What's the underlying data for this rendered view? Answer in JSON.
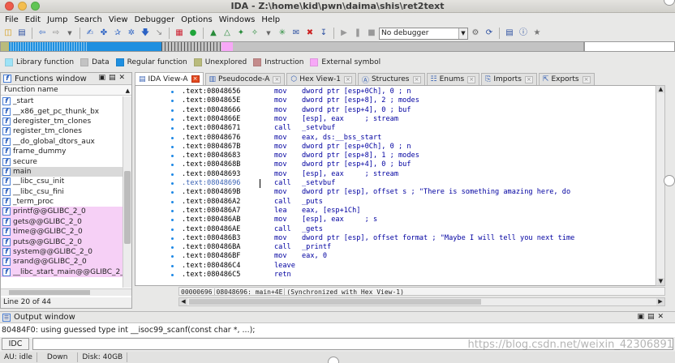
{
  "window": {
    "title": "IDA - Z:\\home\\kid\\pwn\\daima\\shis\\ret2text",
    "traffic_colors": [
      "#ee5c4c",
      "#f4be4f",
      "#61c554"
    ]
  },
  "menu": [
    "File",
    "Edit",
    "Jump",
    "Search",
    "View",
    "Debugger",
    "Options",
    "Windows",
    "Help"
  ],
  "toolbar": {
    "debugger_select": "No debugger"
  },
  "legend": [
    {
      "label": "Library function",
      "color": "#9ee3f7"
    },
    {
      "label": "Data",
      "color": "#c3c3c3"
    },
    {
      "label": "Regular function",
      "color": "#1e8fe0"
    },
    {
      "label": "Unexplored",
      "color": "#b9bb7c"
    },
    {
      "label": "Instruction",
      "color": "#c48b8b"
    },
    {
      "label": "External symbol",
      "color": "#f7a8f7"
    }
  ],
  "functions_window": {
    "title": "Functions window",
    "column_header": "Function name",
    "items": [
      {
        "name": "_start",
        "kind": "regular"
      },
      {
        "name": "__x86_get_pc_thunk_bx",
        "kind": "regular"
      },
      {
        "name": "deregister_tm_clones",
        "kind": "regular"
      },
      {
        "name": "register_tm_clones",
        "kind": "regular"
      },
      {
        "name": "__do_global_dtors_aux",
        "kind": "regular"
      },
      {
        "name": "frame_dummy",
        "kind": "regular"
      },
      {
        "name": "secure",
        "kind": "regular"
      },
      {
        "name": "main",
        "kind": "selected"
      },
      {
        "name": "__libc_csu_init",
        "kind": "regular"
      },
      {
        "name": "__libc_csu_fini",
        "kind": "regular"
      },
      {
        "name": "_term_proc",
        "kind": "regular"
      },
      {
        "name": "printf@@GLIBC_2_0",
        "kind": "import"
      },
      {
        "name": "gets@@GLIBC_2_0",
        "kind": "import"
      },
      {
        "name": "time@@GLIBC_2_0",
        "kind": "import"
      },
      {
        "name": "puts@@GLIBC_2_0",
        "kind": "import"
      },
      {
        "name": "system@@GLIBC_2_0",
        "kind": "import"
      },
      {
        "name": "srand@@GLIBC_2_0",
        "kind": "import"
      },
      {
        "name": "__libc_start_main@@GLIBC_2_0",
        "kind": "import"
      }
    ],
    "status": "Line 20 of 44"
  },
  "tabs": [
    {
      "label": "IDA View-A",
      "icon": "ida-view-icon",
      "active": true
    },
    {
      "label": "Pseudocode-A",
      "icon": "pseudocode-icon",
      "active": false
    },
    {
      "label": "Hex View-1",
      "icon": "hex-view-icon",
      "active": false
    },
    {
      "label": "Structures",
      "icon": "structures-icon",
      "active": false
    },
    {
      "label": "Enums",
      "icon": "enums-icon",
      "active": false
    },
    {
      "label": "Imports",
      "icon": "imports-icon",
      "active": false
    },
    {
      "label": "Exports",
      "icon": "exports-icon",
      "active": false
    }
  ],
  "disasm": {
    "lines": [
      {
        "addr": ".text:08048656",
        "mn": "mov",
        "ops": "dword ptr [esp+0Ch], 0 ; n"
      },
      {
        "addr": ".text:0804865E",
        "mn": "mov",
        "ops": "dword ptr [esp+8], 2 ; modes"
      },
      {
        "addr": ".text:08048666",
        "mn": "mov",
        "ops": "dword ptr [esp+4], 0 ; buf"
      },
      {
        "addr": ".text:0804866E",
        "mn": "mov",
        "ops": "[esp], eax     ; stream"
      },
      {
        "addr": ".text:08048671",
        "mn": "call",
        "ops": "_setvbuf"
      },
      {
        "addr": ".text:08048676",
        "mn": "mov",
        "ops": "eax, ds:__bss_start"
      },
      {
        "addr": ".text:0804867B",
        "mn": "mov",
        "ops": "dword ptr [esp+0Ch], 0 ; n"
      },
      {
        "addr": ".text:08048683",
        "mn": "mov",
        "ops": "dword ptr [esp+8], 1 ; modes"
      },
      {
        "addr": ".text:0804868B",
        "mn": "mov",
        "ops": "dword ptr [esp+4], 0 ; buf"
      },
      {
        "addr": ".text:08048693",
        "mn": "mov",
        "ops": "[esp], eax     ; stream"
      },
      {
        "addr": ".text:08048696",
        "mn": "call",
        "ops": "_setvbuf",
        "current": true
      },
      {
        "addr": ".text:0804869B",
        "mn": "mov",
        "ops": "dword ptr [esp], offset s ; \"There is something amazing here, do"
      },
      {
        "addr": ".text:080486A2",
        "mn": "call",
        "ops": "_puts"
      },
      {
        "addr": ".text:080486A7",
        "mn": "lea",
        "ops": "eax, [esp+1Ch]"
      },
      {
        "addr": ".text:080486AB",
        "mn": "mov",
        "ops": "[esp], eax     ; s"
      },
      {
        "addr": ".text:080486AE",
        "mn": "call",
        "ops": "_gets"
      },
      {
        "addr": ".text:080486B3",
        "mn": "mov",
        "ops": "dword ptr [esp], offset format ; \"Maybe I will tell you next time"
      },
      {
        "addr": ".text:080486BA",
        "mn": "call",
        "ops": "_printf"
      },
      {
        "addr": ".text:080486BF",
        "mn": "mov",
        "ops": "eax, 0"
      },
      {
        "addr": ".text:080486C4",
        "mn": "leave",
        "ops": ""
      },
      {
        "addr": ".text:080486C5",
        "mn": "retn",
        "ops": ""
      }
    ],
    "status_offset": "00000696",
    "status_location": "08048696: main+4E",
    "status_sync": "(Synchronized with Hex View-1)"
  },
  "output": {
    "title": "Output window",
    "text": "80484F0: using guessed type int __isoc99_scanf(const char *, ...);",
    "idc_label": "IDC"
  },
  "statusbar": {
    "au": "AU:  idle",
    "direction": "Down",
    "disk": "Disk: 40GB"
  },
  "watermark": "https://blog.csdn.net/weixin_42306891"
}
